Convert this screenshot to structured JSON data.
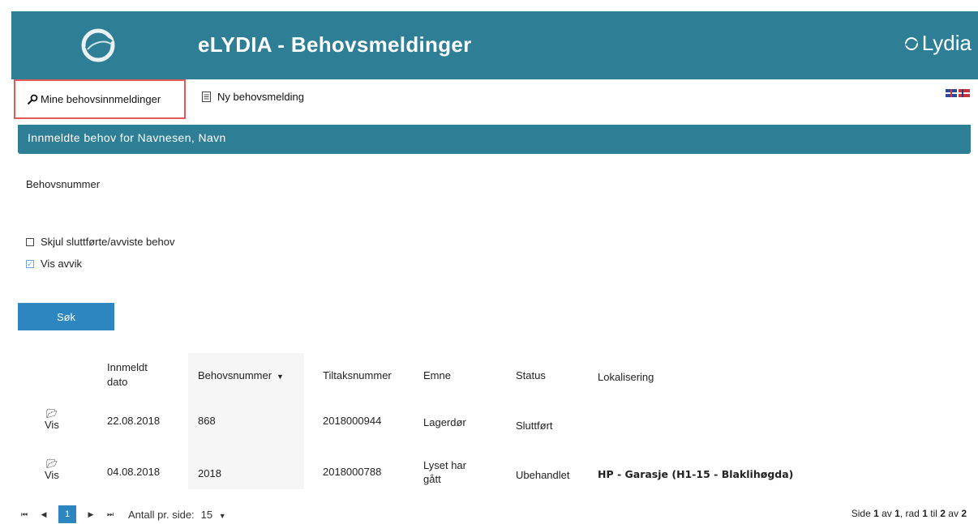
{
  "header": {
    "title": "eLYDIA - Behovsmeldinger",
    "brand": "Lydia",
    "color": "#2e7f95"
  },
  "toolbar": {
    "mine_label": "Mine behovsinnmeldinger",
    "new_label": "Ny behovsmelding",
    "highlight_color": "#e25b57"
  },
  "section": {
    "title": "Innmeldte behov for Navnesen, Navn"
  },
  "filters": {
    "behovsnummer_label": "Behovsnummer",
    "hide_completed_label": "Skjul sluttførte/avviste behov",
    "hide_completed_checked": false,
    "show_deviations_label": "Vis avvik",
    "show_deviations_checked": true,
    "search_button": "Søk"
  },
  "table": {
    "columns": {
      "innmeldt": "Innmeldt dato",
      "behovsnummer": "Behovsnummer",
      "sort_arrow": "▼",
      "tiltaksnummer": "Tiltaksnummer",
      "emne": "Emne",
      "status": "Status",
      "lokalisering": "Lokalisering"
    },
    "rows": [
      {
        "action": "Vis",
        "innmeldt": "22.08.2018",
        "behovsnummer": "868",
        "tiltaksnummer": "2018000944",
        "emne": "Lagerdør",
        "status": "Sluttført",
        "lokalisering": ""
      },
      {
        "action": "Vis",
        "innmeldt": "04.08.2018",
        "behovsnummer": "2018",
        "tiltaksnummer": "2018000788",
        "emne": "Lyset har gått",
        "status": "Ubehandlet",
        "lokalisering": "HP - Garasje (H1-15 - Blaklihøgda)"
      }
    ]
  },
  "pager": {
    "current_page": "1",
    "per_page_label": "Antall pr. side:",
    "per_page_value": "15",
    "per_page_arrow": "▼",
    "summary_prefix": "Side",
    "summary_page": "1",
    "summary_mid1": "av",
    "summary_total_pages": "1",
    "summary_mid2": ", rad",
    "summary_from": "1",
    "summary_mid3": "til",
    "summary_to": "2",
    "summary_mid4": "av",
    "summary_total": "2"
  }
}
